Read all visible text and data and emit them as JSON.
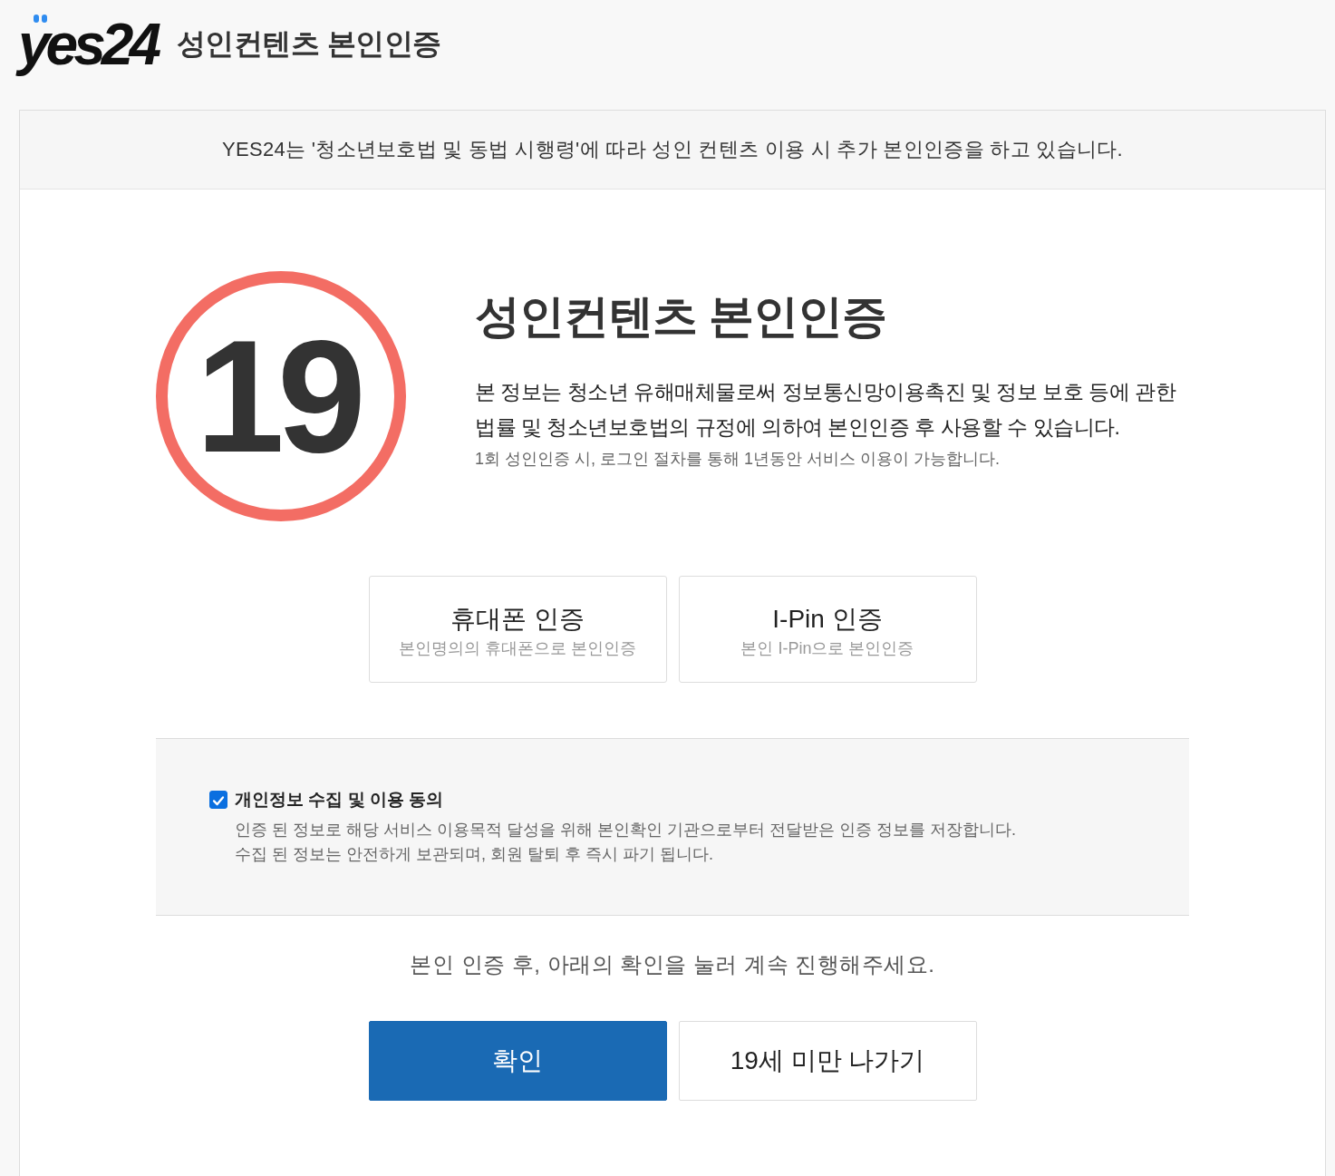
{
  "header": {
    "logo": "yes24",
    "title": "성인컨텐츠 본인인증"
  },
  "notice": "YES24는 '청소년보호법 및 동법 시행령'에 따라 성인 컨텐츠 이용 시 추가 본인인증을 하고 있습니다.",
  "intro": {
    "badge": "19",
    "heading": "성인컨텐츠 본인인증",
    "description": "본 정보는 청소년 유해매체물로써 정보통신망이용촉진 및 정보 보호 등에 관한 법률 및 청소년보호법의 규정에 의하여 본인인증 후 사용할 수 있습니다.",
    "note": "1회 성인인증 시, 로그인 절차를 통해 1년동안 서비스 이용이 가능합니다."
  },
  "verification_methods": [
    {
      "title": "휴대폰 인증",
      "subtitle": "본인명의의 휴대폰으로 본인인증"
    },
    {
      "title": "I-Pin 인증",
      "subtitle": "본인 I-Pin으로 본인인증"
    }
  ],
  "consent": {
    "label": "개인정보 수집 및 이용 동의",
    "checked": true,
    "details": [
      "인증 된 정보로 해당 서비스 이용목적 달성을 위해 본인확인 기관으로부터 전달받은 인증 정보를 저장합니다.",
      "수집 된 정보는 안전하게 보관되며, 회원 탈퇴 후 즉시 파기 됩니다."
    ]
  },
  "instruction": "본인 인증 후, 아래의 확인을 눌러 계속 진행해주세요.",
  "buttons": [
    {
      "label": "확인",
      "kind": "primary"
    },
    {
      "label": "19세 미만 나가기",
      "kind": "secondary"
    }
  ]
}
